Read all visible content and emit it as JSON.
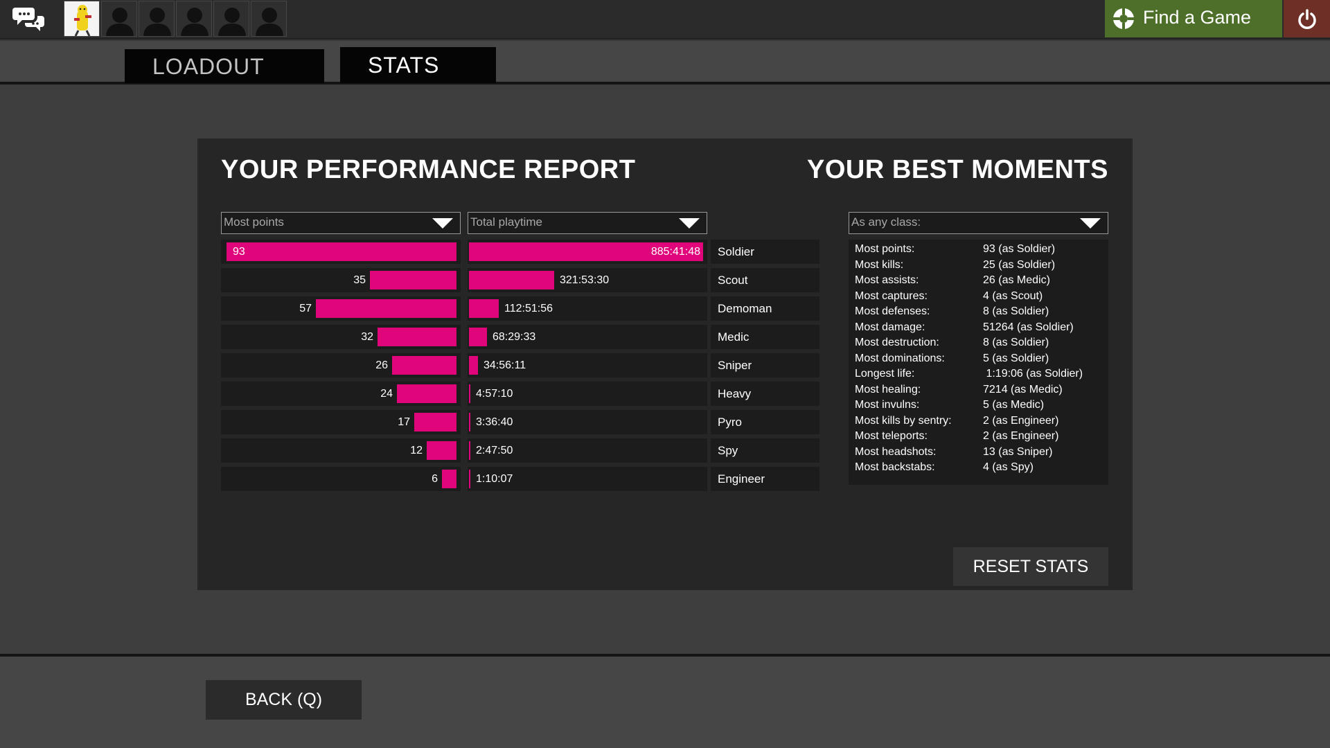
{
  "topbar": {
    "chat_icon": "chat-bubbles-icon",
    "party_slots": [
      {
        "state": "player",
        "icon": "player-avatar-icon"
      },
      {
        "state": "empty",
        "icon": "empty-slot-silhouette-icon"
      },
      {
        "state": "empty",
        "icon": "empty-slot-silhouette-icon"
      },
      {
        "state": "empty",
        "icon": "empty-slot-silhouette-icon"
      },
      {
        "state": "empty",
        "icon": "empty-slot-silhouette-icon"
      },
      {
        "state": "empty",
        "icon": "empty-slot-silhouette-icon"
      }
    ],
    "find_game_label": "Find a Game",
    "find_game_icon": "tf2-logo-icon",
    "quit_icon": "power-icon",
    "colors": {
      "find_game": "#4d6f2a",
      "quit": "#6e2f27"
    }
  },
  "tabs": [
    {
      "label": "LOADOUT",
      "active": false
    },
    {
      "label": "STATS",
      "active": true
    }
  ],
  "performance": {
    "title": "YOUR PERFORMANCE REPORT",
    "points_dropdown": "Most points",
    "playtime_dropdown": "Total playtime",
    "bar_color": "#e1057c",
    "rows": [
      {
        "class": "Soldier",
        "points": 93,
        "points_label": "93",
        "playtime_hours": 885.695,
        "playtime_label": "885:41:48"
      },
      {
        "class": "Scout",
        "points": 35,
        "points_label": "35",
        "playtime_hours": 321.892,
        "playtime_label": "321:53:30"
      },
      {
        "class": "Demoman",
        "points": 57,
        "points_label": "57",
        "playtime_hours": 112.866,
        "playtime_label": "112:51:56"
      },
      {
        "class": "Medic",
        "points": 32,
        "points_label": "32",
        "playtime_hours": 68.493,
        "playtime_label": "68:29:33"
      },
      {
        "class": "Sniper",
        "points": 26,
        "points_label": "26",
        "playtime_hours": 34.936,
        "playtime_label": "34:56:11"
      },
      {
        "class": "Heavy",
        "points": 24,
        "points_label": "24",
        "playtime_hours": 4.953,
        "playtime_label": "4:57:10"
      },
      {
        "class": "Pyro",
        "points": 17,
        "points_label": "17",
        "playtime_hours": 3.611,
        "playtime_label": "3:36:40"
      },
      {
        "class": "Spy",
        "points": 12,
        "points_label": "12",
        "playtime_hours": 2.797,
        "playtime_label": "2:47:50"
      },
      {
        "class": "Engineer",
        "points": 6,
        "points_label": "6",
        "playtime_hours": 1.169,
        "playtime_label": "1:10:07"
      }
    ]
  },
  "moments": {
    "title": "YOUR BEST MOMENTS",
    "class_dropdown": "As any class:",
    "items": [
      {
        "label": "Most points:",
        "value": "93 (as Soldier)"
      },
      {
        "label": "Most kills:",
        "value": "25 (as Soldier)"
      },
      {
        "label": "Most assists:",
        "value": "26 (as Medic)"
      },
      {
        "label": "Most captures:",
        "value": "4 (as Scout)"
      },
      {
        "label": "Most defenses:",
        "value": "8 (as Soldier)"
      },
      {
        "label": "Most damage:",
        "value": "51264 (as Soldier)"
      },
      {
        "label": "Most destruction:",
        "value": "8 (as Soldier)"
      },
      {
        "label": "Most dominations:",
        "value": "5 (as Soldier)"
      },
      {
        "label": "Longest life:",
        "value": " 1:19:06 (as Soldier)"
      },
      {
        "label": "Most healing:",
        "value": "7214 (as Medic)"
      },
      {
        "label": "Most invulns:",
        "value": "5 (as Medic)"
      },
      {
        "label": "Most kills by sentry:",
        "value": "2 (as Engineer)"
      },
      {
        "label": "Most teleports:",
        "value": "2 (as Engineer)"
      },
      {
        "label": "Most headshots:",
        "value": "13 (as Sniper)"
      },
      {
        "label": "Most backstabs:",
        "value": "4 (as Spy)"
      }
    ],
    "reset_label": "RESET STATS"
  },
  "footer": {
    "back_label": "BACK (Q)"
  }
}
